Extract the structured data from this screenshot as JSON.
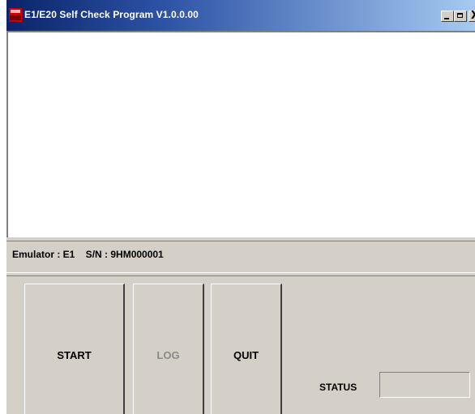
{
  "window": {
    "title": "E1/E20 Self Check Program V1.0.0.00",
    "icon": "e1-e20-app-icon",
    "controls": {
      "minimize_icon": "minimize-icon",
      "maximize_icon": "maximize-icon",
      "close_glyph": "X"
    }
  },
  "log": {
    "text": ""
  },
  "info": {
    "text": "Emulator : E1    S/N : 9HM000001"
  },
  "buttons": {
    "start": "START",
    "log": "LOG",
    "quit": "QUIT"
  },
  "status": {
    "label": "STATUS",
    "value": ""
  }
}
